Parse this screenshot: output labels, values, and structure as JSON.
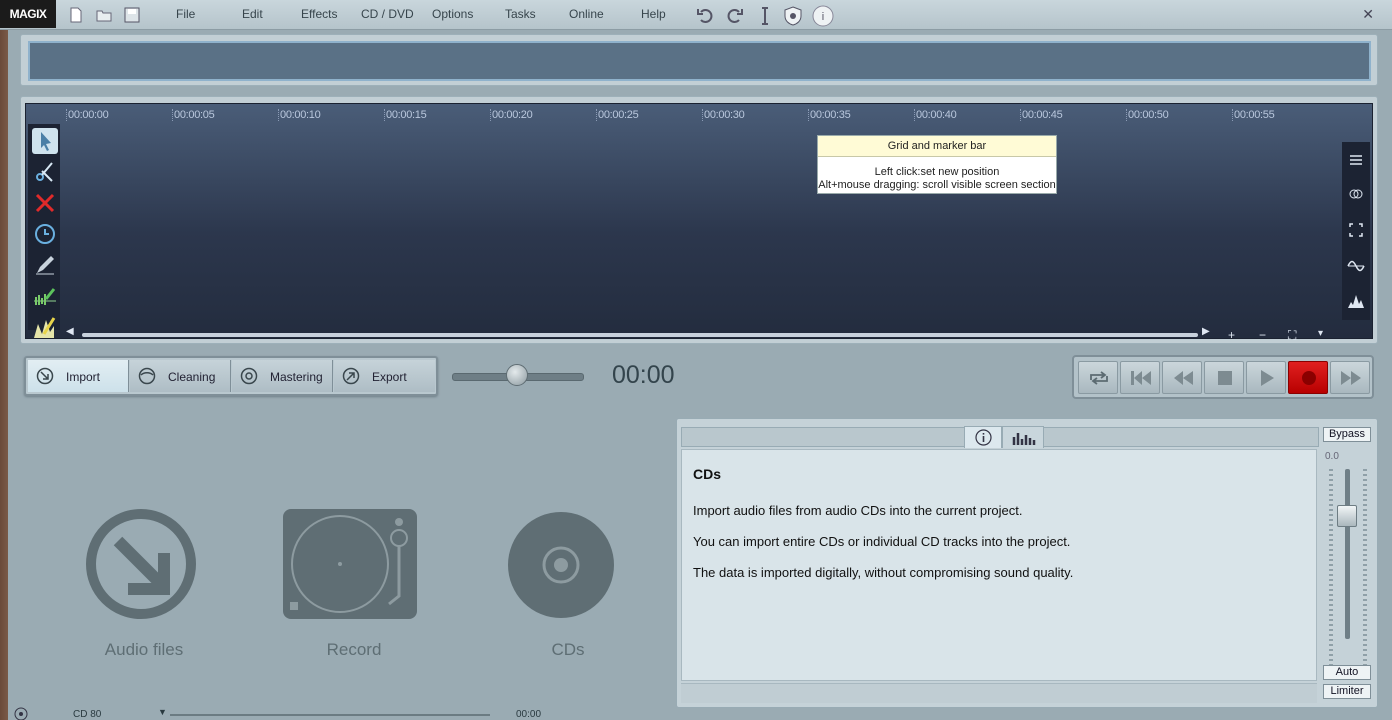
{
  "app": {
    "logo": "MAGIX"
  },
  "menu": [
    "File",
    "Edit",
    "Effects",
    "CD / DVD",
    "Options",
    "Tasks",
    "Online",
    "Help"
  ],
  "ruler": {
    "ticks": [
      "00:00:00",
      "00:00:05",
      "00:00:10",
      "00:00:15",
      "00:00:20",
      "00:00:25",
      "00:00:30",
      "00:00:35",
      "00:00:40",
      "00:00:45",
      "00:00:50",
      "00:00:55"
    ]
  },
  "arranger_tools": {
    "left": [
      "pointer-icon",
      "scissors-icon",
      "delete-icon",
      "clock-icon",
      "draw-icon",
      "waveform-draw-icon",
      "volume-draw-icon"
    ],
    "right": [
      "menu-icon",
      "link-icon",
      "fullscreen-icon",
      "curve-icon",
      "spectrum-icon"
    ],
    "bottom": [
      "+",
      "−",
      "⛶",
      "▾"
    ]
  },
  "tooltip": {
    "title": "Grid and marker bar",
    "line1": "Left click:set new position",
    "line2": "Alt+mouse dragging: scroll visible screen section"
  },
  "modes": [
    {
      "label": "Import",
      "icon": "import-icon",
      "active": true
    },
    {
      "label": "Cleaning",
      "icon": "cleaning-icon",
      "active": false
    },
    {
      "label": "Mastering",
      "icon": "mastering-icon",
      "active": false
    },
    {
      "label": "Export",
      "icon": "export-icon",
      "active": false
    }
  ],
  "time_display": "00:00",
  "position_slider": 0.5,
  "transport": [
    "loop-icon",
    "to-start-icon",
    "rewind-icon",
    "stop-icon",
    "play-icon",
    "record-icon",
    "forward-icon"
  ],
  "sources": [
    {
      "label": "Audio files",
      "icon": "audio-files-icon"
    },
    {
      "label": "Record",
      "icon": "turntable-icon"
    },
    {
      "label": "CDs",
      "icon": "cd-icon"
    }
  ],
  "info": {
    "title": "CDs",
    "lines": [
      "Import audio files from audio CDs into the current project.",
      "You can import entire CDs or individual CD tracks into the project.",
      "The data is imported digitally, without compromising sound quality."
    ],
    "tab_icons": [
      "info-icon",
      "equalizer-icon"
    ]
  },
  "master": {
    "bypass": "Bypass",
    "db_value": "0.0",
    "auto": "Auto",
    "limiter": "Limiter"
  },
  "status": {
    "disc": "CD 80",
    "time": "00:00"
  },
  "colors": {
    "record": "#d10000",
    "arranger_top": "#4a5d78",
    "arranger_bottom": "#232c3e",
    "accent": "#8fb2cc"
  }
}
